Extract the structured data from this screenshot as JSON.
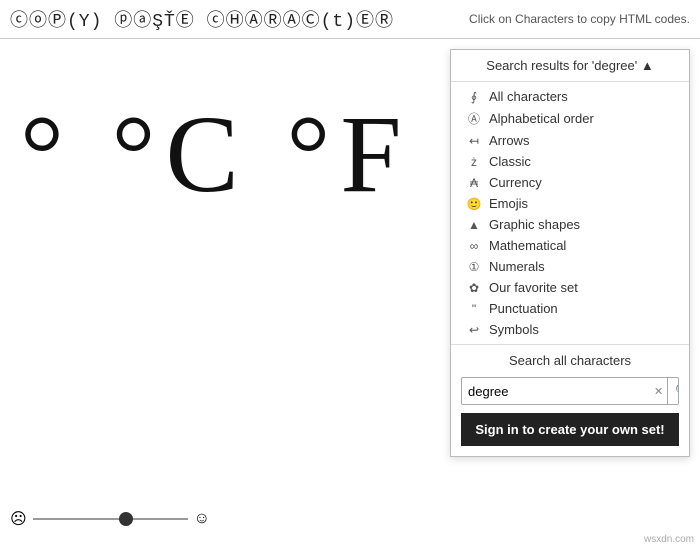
{
  "header": {
    "logo": "ⓒⓞⓅ(Y) ⓟⓐŞŤⒺ ⓒⒽⒶⓇⒶⒸ(t)ⒺⓇ",
    "hint": "Click on Characters to copy HTML codes."
  },
  "big_chars": "° °C °F",
  "slider": {
    "face_left": "☹",
    "face_right": "☺"
  },
  "dropdown": {
    "header_text": "Search results for 'degree' ▲",
    "items": [
      {
        "icon": "∮",
        "label": "All characters"
      },
      {
        "icon": "Ⓐ",
        "label": "Alphabetical order"
      },
      {
        "icon": "↤",
        "label": "Arrows"
      },
      {
        "icon": "ż",
        "label": "Classic"
      },
      {
        "icon": "₳",
        "label": "Currency"
      },
      {
        "icon": "🙂",
        "label": "Emojis"
      },
      {
        "icon": "▲",
        "label": "Graphic shapes"
      },
      {
        "icon": "∞",
        "label": "Mathematical"
      },
      {
        "icon": "①",
        "label": "Numerals"
      },
      {
        "icon": "✿",
        "label": "Our favorite set"
      },
      {
        "icon": "\"",
        "label": "Punctuation"
      },
      {
        "icon": "↩",
        "label": "Symbols"
      }
    ],
    "search_all_label": "Search all characters",
    "search_input_value": "degree",
    "search_clear": "✕",
    "search_icon": "🔍",
    "sign_in_label": "Sign in to create your own set!"
  },
  "watermark": "wsxdn.com"
}
